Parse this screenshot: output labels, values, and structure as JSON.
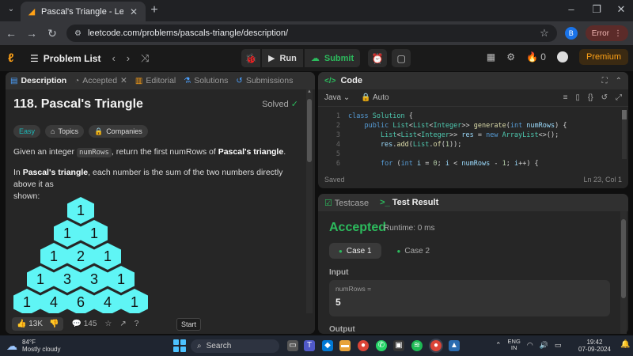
{
  "browser": {
    "tab_title": "Pascal's Triangle - LeetCode",
    "url": "leetcode.com/problems/pascals-triangle/description/",
    "profile_initial": "B",
    "error_label": "Error"
  },
  "header": {
    "problem_list": "Problem List",
    "run": "Run",
    "submit": "Submit",
    "streak": "0",
    "premium": "Premium"
  },
  "left_tabs": [
    {
      "label": "Description"
    },
    {
      "label": "Accepted"
    },
    {
      "label": "Editorial"
    },
    {
      "label": "Solutions"
    },
    {
      "label": "Submissions"
    }
  ],
  "problem": {
    "title": "118. Pascal's Triangle",
    "status": "Solved",
    "difficulty": "Easy",
    "topics": "Topics",
    "companies": "Companies",
    "p1_a": "Given an integer ",
    "p1_code": "numRows",
    "p1_b": ", return the first numRows of ",
    "p1_bold": "Pascal's triangle",
    "p1_c": ".",
    "p2_a": "In ",
    "p2_bold": "Pascal's triangle",
    "p2_b": ", each number is the sum of the two numbers directly above it as",
    "p2_c": "shown:",
    "triangle": [
      [
        1
      ],
      [
        1,
        1
      ],
      [
        1,
        2,
        1
      ],
      [
        1,
        3,
        3,
        1
      ],
      [
        1,
        4,
        6,
        4,
        1
      ]
    ]
  },
  "footer": {
    "likes": "13K",
    "comments": "145",
    "tooltip": "Start"
  },
  "code": {
    "title": "Code",
    "language": "Java",
    "mode": "Auto",
    "status": "Saved",
    "cursor": "Ln 23, Col 1",
    "line_numbers": [
      "1",
      "2",
      "3",
      "4",
      "5",
      "6"
    ]
  },
  "test": {
    "tab1": "Testcase",
    "tab2": "Test Result",
    "result": "Accepted",
    "runtime": "Runtime: 0 ms",
    "case1": "Case 1",
    "case2": "Case 2",
    "input_label": "Input",
    "var_name": "numRows =",
    "var_value": "5",
    "output_label": "Output"
  },
  "taskbar": {
    "temp": "84°F",
    "weather": "Mostly cloudy",
    "search": "Search",
    "lang1": "ENG",
    "lang2": "IN",
    "time": "19:42",
    "date": "07-09-2024"
  }
}
